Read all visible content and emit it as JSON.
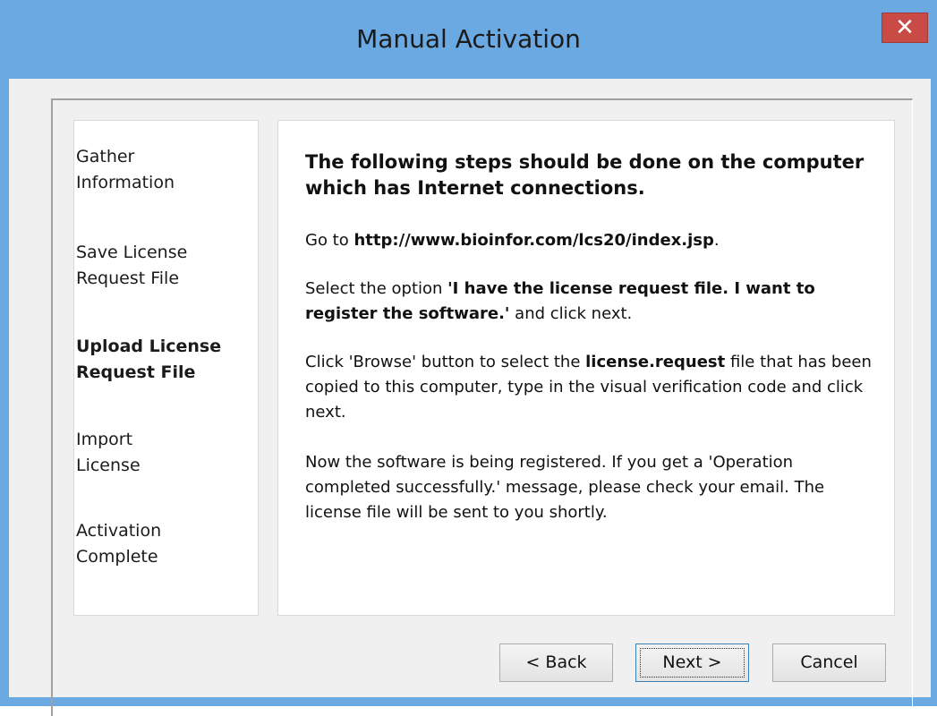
{
  "window": {
    "title": "Manual Activation",
    "close_glyph": "✕"
  },
  "steps": [
    {
      "line1": "Gather",
      "line2": "Information",
      "active": false
    },
    {
      "line1": "Save License",
      "line2": "Request File",
      "active": false
    },
    {
      "line1": "Upload License",
      "line2": "Request File",
      "active": true
    },
    {
      "line1": "Import",
      "line2": "License",
      "active": false
    },
    {
      "line1": "Activation",
      "line2": "Complete",
      "active": false
    }
  ],
  "content": {
    "heading": "The following steps should be done on the computer which has Internet connections.",
    "goto_prefix": "Go to ",
    "goto_url": "http://www.bioinfor.com/lcs20/index.jsp",
    "goto_suffix": ".",
    "select_prefix": "Select the option ",
    "select_option": "'I have the license request file. I want to register the software.'",
    "select_suffix": " and click next.",
    "browse_prefix": "Click 'Browse' button to select the ",
    "browse_file": "license.request",
    "browse_suffix": " file that has been copied to this computer, type in the visual verification code and click next.",
    "registered_text": "Now the software is being registered. If you get a 'Operation completed successfully.' message, please check your email. The license file will be sent to you shortly."
  },
  "buttons": {
    "back": "< Back",
    "next": "Next >",
    "cancel": "Cancel"
  }
}
